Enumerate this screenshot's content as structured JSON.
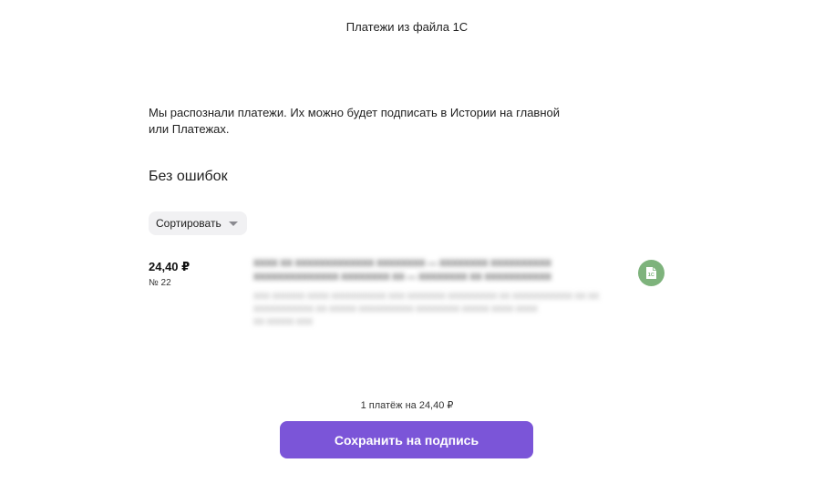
{
  "header": {
    "title": "Платежи из файла 1С"
  },
  "intro": {
    "text_line1": "Мы распознали платежи. Их можно будет подписать в Истории на главной",
    "text_line2": "или Платежах."
  },
  "section": {
    "title": "Без ошибок"
  },
  "sort": {
    "label": "Сортировать",
    "icon": "chevron-down-icon"
  },
  "payments": [
    {
      "amount": "24,40 ₽",
      "number": "№ 22",
      "source_icon": "1c-doc-icon",
      "source_color": "#7eb37c"
    }
  ],
  "summary": {
    "text": "1 платёж на 24,40 ₽"
  },
  "actions": {
    "save_label": "Сохранить на подпись",
    "accent_color": "#7b55d8"
  }
}
